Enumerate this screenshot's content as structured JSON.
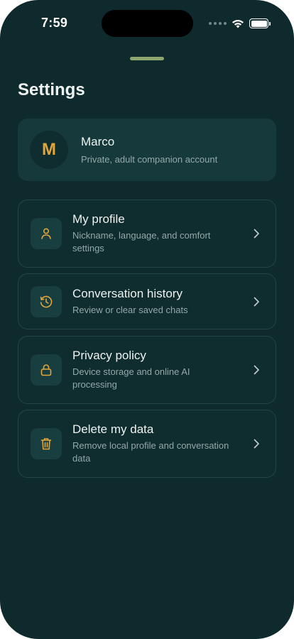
{
  "status_bar": {
    "time": "7:59"
  },
  "header": {
    "title": "Settings"
  },
  "account": {
    "initial": "M",
    "name": "Marco",
    "subtitle": "Private, adult companion account"
  },
  "menu": [
    {
      "title": "My profile",
      "subtitle": "Nickname, language, and comfort settings",
      "icon": "person-icon"
    },
    {
      "title": "Conversation history",
      "subtitle": "Review or clear saved chats",
      "icon": "history-icon"
    },
    {
      "title": "Privacy policy",
      "subtitle": "Device storage and online AI processing",
      "icon": "lock-icon"
    },
    {
      "title": "Delete my data",
      "subtitle": "Remove local profile and conversation data",
      "icon": "trash-icon"
    }
  ],
  "colors": {
    "background": "#0e2a2c",
    "accent": "#e0a63b",
    "grabber": "#8fa56e"
  }
}
